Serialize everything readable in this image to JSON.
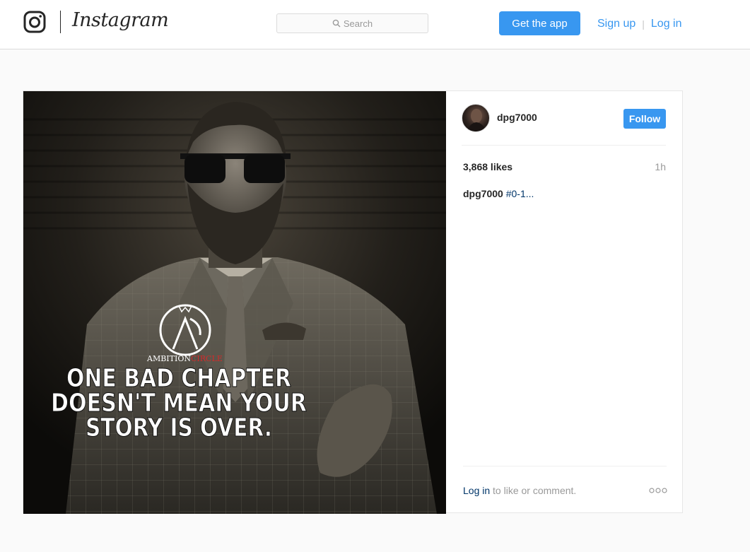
{
  "header": {
    "wordmark": "Instagram",
    "search_placeholder": "Search",
    "get_app_label": "Get the app",
    "signup_label": "Sign up",
    "separator": "|",
    "login_label": "Log in"
  },
  "post": {
    "image": {
      "brand_a": "AMBITION",
      "brand_b": "CIRCLE",
      "quote_line1": "ONE BAD CHAPTER",
      "quote_line2": "DOESN'T MEAN YOUR",
      "quote_line3": "STORY IS OVER."
    },
    "author": {
      "username": "dpg7000"
    },
    "follow_label": "Follow",
    "likes": "3,868 likes",
    "time": "1h",
    "caption": {
      "username": "dpg7000",
      "text": "#0-1..."
    },
    "login_link": "Log in",
    "login_suffix": " to like or comment."
  },
  "icons": {
    "logo": "instagram-camera-icon",
    "search": "magnifier-icon",
    "more": "more-options-icon"
  },
  "colors": {
    "primary_blue": "#3897f0",
    "link_dark_blue": "#003569",
    "brand_red": "#d22b2b",
    "border": "#dbdbdb",
    "background": "#fafafa"
  }
}
